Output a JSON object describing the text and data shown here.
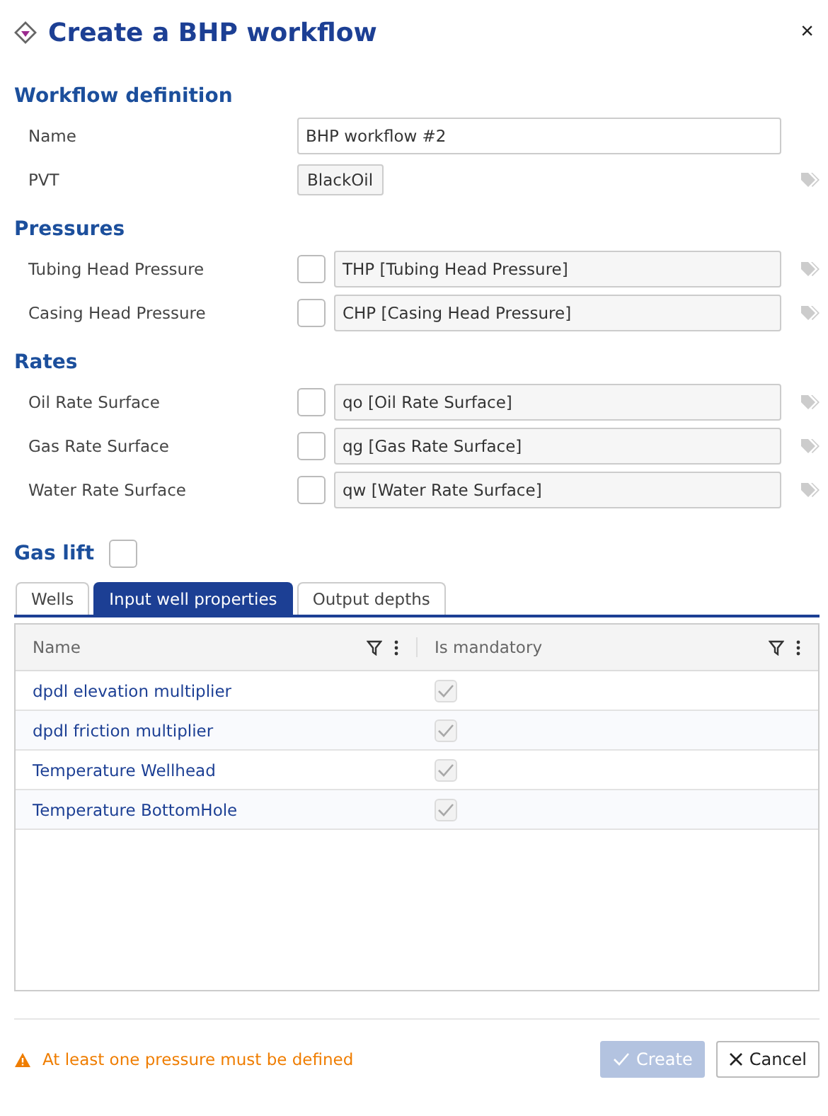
{
  "dialog": {
    "title": "Create a BHP workflow",
    "close": "×"
  },
  "workflow_definition": {
    "heading": "Workflow definition",
    "name": {
      "label": "Name",
      "value": "BHP workflow #2"
    },
    "pvt": {
      "label": "PVT",
      "value": "BlackOil"
    }
  },
  "pressures": {
    "heading": "Pressures",
    "items": [
      {
        "label": "Tubing Head Pressure",
        "checked": false,
        "value": "THP [Tubing Head Pressure]"
      },
      {
        "label": "Casing Head Pressure",
        "checked": false,
        "value": "CHP [Casing Head Pressure]"
      }
    ]
  },
  "rates": {
    "heading": "Rates",
    "items": [
      {
        "label": "Oil Rate Surface",
        "checked": false,
        "value": "qo [Oil Rate Surface]"
      },
      {
        "label": "Gas Rate Surface",
        "checked": false,
        "value": "qg [Gas Rate Surface]"
      },
      {
        "label": "Water Rate Surface",
        "checked": false,
        "value": "qw [Water Rate Surface]"
      }
    ]
  },
  "gas_lift": {
    "heading": "Gas lift",
    "checked": false
  },
  "tabs": [
    {
      "label": "Wells",
      "selected": false
    },
    {
      "label": "Input well properties",
      "selected": true
    },
    {
      "label": "Output depths",
      "selected": false
    }
  ],
  "table": {
    "columns": [
      "Name",
      "Is mandatory"
    ],
    "rows": [
      {
        "name": "dpdl elevation multiplier",
        "mandatory": true
      },
      {
        "name": "dpdl friction multiplier",
        "mandatory": true
      },
      {
        "name": "Temperature Wellhead",
        "mandatory": true
      },
      {
        "name": "Temperature BottomHole",
        "mandatory": true
      }
    ]
  },
  "footer": {
    "warning": "At least one pressure must be defined",
    "create": {
      "label": "Create",
      "disabled": true
    },
    "cancel": {
      "label": "Cancel"
    }
  }
}
